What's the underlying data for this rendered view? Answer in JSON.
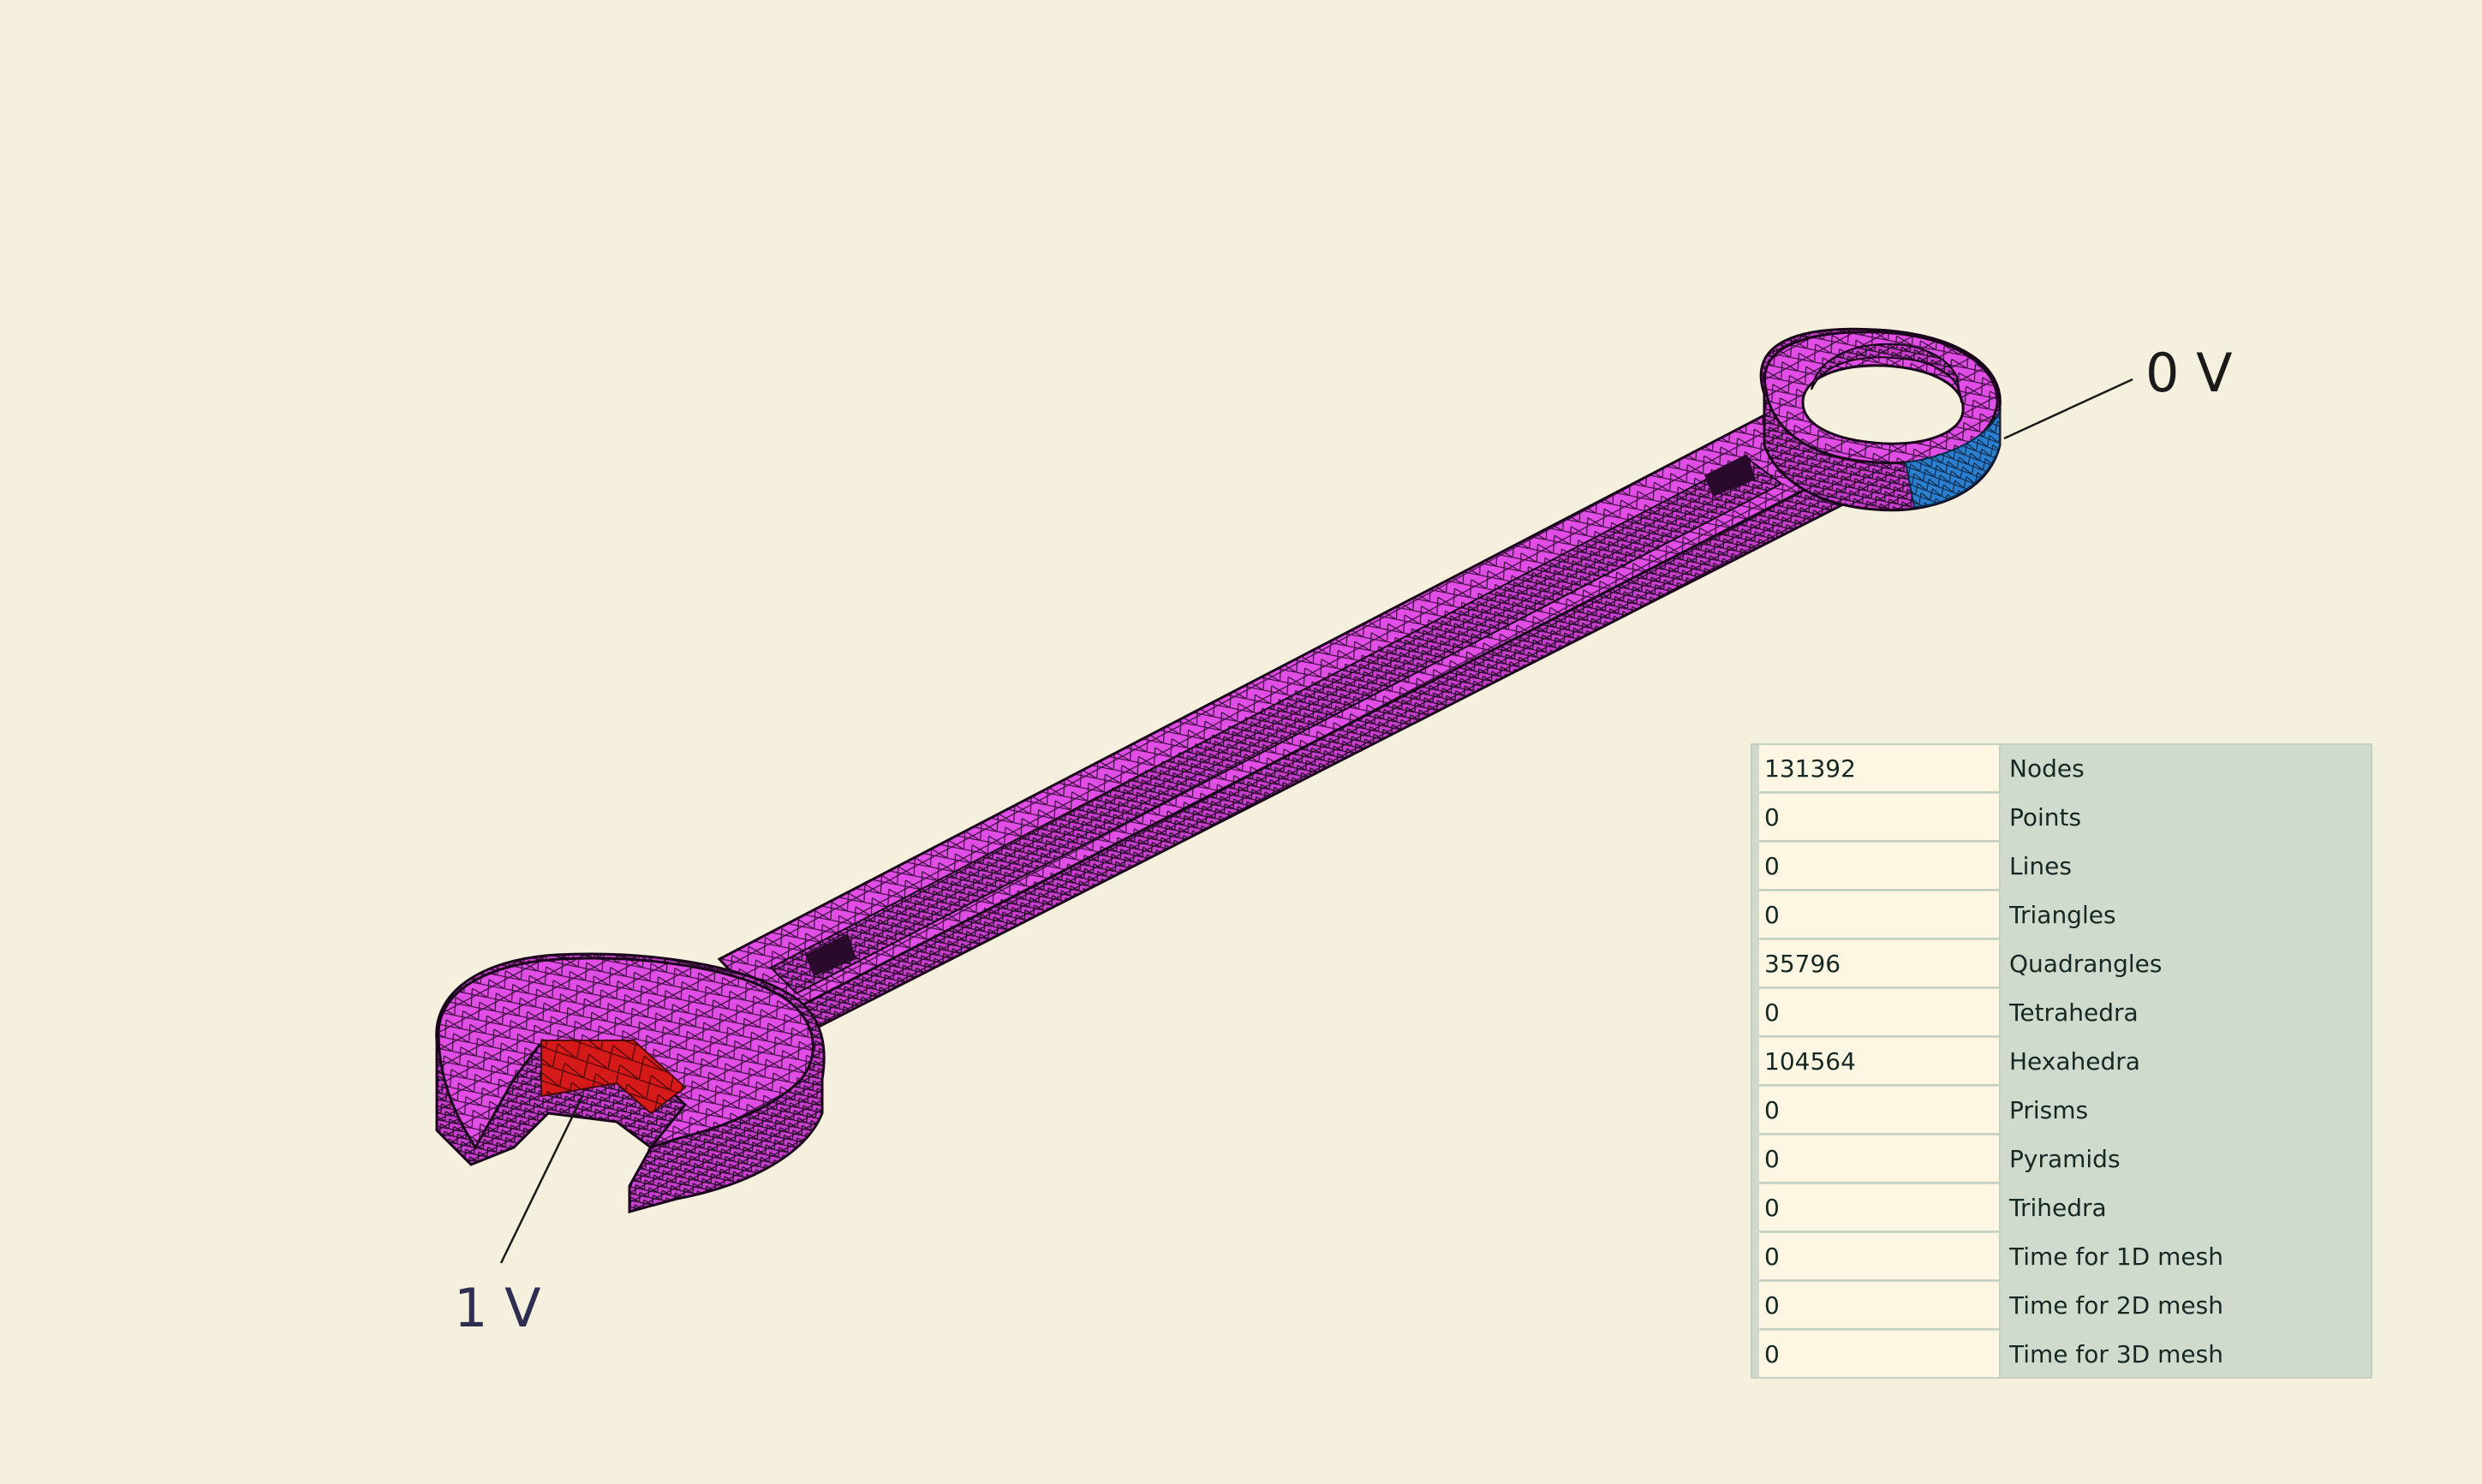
{
  "viewport": {
    "background": "#f5f0dd",
    "model": {
      "mesh_color": "#e14ee6",
      "edge_color": "#2a0a2c",
      "electrode_0v_color": "#2b7fcf",
      "electrode_1v_color": "#d61a1a"
    },
    "annotations": [
      {
        "id": "label-0v",
        "text": "0 V"
      },
      {
        "id": "label-1v",
        "text": "1 V"
      }
    ]
  },
  "mesh_statistics": {
    "rows": [
      {
        "value": "131392",
        "label": "Nodes"
      },
      {
        "value": "0",
        "label": "Points"
      },
      {
        "value": "0",
        "label": "Lines"
      },
      {
        "value": "0",
        "label": "Triangles"
      },
      {
        "value": "35796",
        "label": "Quadrangles"
      },
      {
        "value": "0",
        "label": "Tetrahedra"
      },
      {
        "value": "104564",
        "label": "Hexahedra"
      },
      {
        "value": "0",
        "label": "Prisms"
      },
      {
        "value": "0",
        "label": "Pyramids"
      },
      {
        "value": "0",
        "label": "Trihedra"
      },
      {
        "value": "0",
        "label": "Time for 1D mesh"
      },
      {
        "value": "0",
        "label": "Time for 2D mesh"
      },
      {
        "value": "0",
        "label": "Time for 3D mesh"
      }
    ]
  }
}
